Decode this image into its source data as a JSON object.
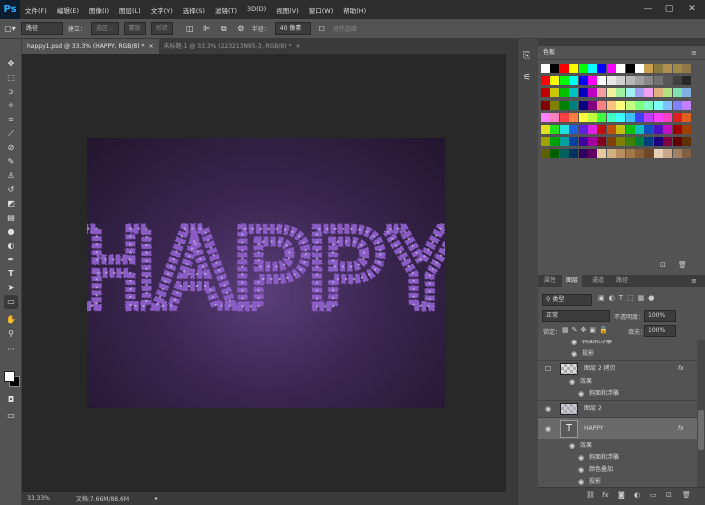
{
  "app": {
    "logo": "Ps"
  },
  "menu": [
    "文件(F)",
    "编辑(E)",
    "图像(I)",
    "图层(L)",
    "文字(Y)",
    "选择(S)",
    "滤镜(T)",
    "3D(D)",
    "视图(V)",
    "窗口(W)",
    "帮助(H)"
  ],
  "window_controls": {
    "minimize": "—",
    "maximize": "▢",
    "close": "✕"
  },
  "options": {
    "mode": "路径",
    "create_label": "建立：",
    "selection": "选区...",
    "mask": "蒙版",
    "shape": "形状",
    "radius_label": "半径：",
    "radius_value": "40 像素",
    "align_edges": "对齐边缘"
  },
  "tabs": [
    {
      "label": "happy1.psd @ 33.3% (HAPPY, RGB/8) *",
      "close": "×"
    },
    {
      "label": "未标题-1 @ 33.3% (223213N95-3, RGB/8) *",
      "close": "×"
    }
  ],
  "canvas": {
    "text": "HAPPY",
    "text_color": "#8a5bc4",
    "bg_color": "#3a2650"
  },
  "status": {
    "zoom": "33.33%",
    "doc": "文档:7.66M/88.6M"
  },
  "swatches_panel": {
    "title": "色板"
  },
  "swatch_colors": [
    [
      "#ffffff",
      "#000000",
      "#ff0000",
      "#ffff00",
      "#00ff00",
      "#00ffff",
      "#0000ff",
      "#ff00ff",
      "#ffffff",
      "#000000",
      "#ffffff",
      "#c8a050",
      "#8a7a40",
      "#b09050",
      "#a08848",
      "#907848"
    ],
    [
      "#ff0000",
      "#ffff00",
      "#00ff00",
      "#00ffff",
      "#0000ff",
      "#ff00ff",
      "#ffffff",
      "#e8e8e8",
      "#d0d0d0",
      "#b8b8b8",
      "#a0a0a0",
      "#888888",
      "#707070",
      "#585858",
      "#404040",
      "#282828"
    ],
    [
      "#c00000",
      "#c8c800",
      "#00c000",
      "#00c0c0",
      "#0000c0",
      "#c000c0",
      "#f0a0a0",
      "#f0f0a0",
      "#a0f0a0",
      "#a0f0f0",
      "#a0a0f0",
      "#f0a0f0",
      "#e0b080",
      "#b0e080",
      "#80e0b0",
      "#80b0e0"
    ],
    [
      "#800000",
      "#808000",
      "#008000",
      "#008080",
      "#000080",
      "#800080",
      "#ff8080",
      "#ffc080",
      "#ffff80",
      "#c0ff80",
      "#80ff80",
      "#80ffc0",
      "#80ffff",
      "#80c0ff",
      "#8080ff",
      "#c080ff"
    ],
    [
      "#ff80ff",
      "#ff80c0",
      "#ff4040",
      "#ff8040",
      "#ffff40",
      "#c0ff40",
      "#40ff40",
      "#40ffc0",
      "#40ffff",
      "#40c0ff",
      "#4040ff",
      "#c040ff",
      "#ff40ff",
      "#ff40c0",
      "#e02020",
      "#e06020"
    ],
    [
      "#e0e020",
      "#20e020",
      "#20e0e0",
      "#2060e0",
      "#6020e0",
      "#e020e0",
      "#c01010",
      "#c05010",
      "#c0c010",
      "#10c010",
      "#10c0c0",
      "#1050c0",
      "#5010c0",
      "#c010c0",
      "#a00000",
      "#a04000"
    ],
    [
      "#a0a000",
      "#00a000",
      "#00a0a0",
      "#0040a0",
      "#4000a0",
      "#a000a0",
      "#800020",
      "#804000",
      "#808000",
      "#408000",
      "#008040",
      "#004080",
      "#200080",
      "#800040",
      "#600000",
      "#603000"
    ],
    [
      "#606000",
      "#006000",
      "#006060",
      "#003060",
      "#300060",
      "#600060",
      "#e8c8a0",
      "#d0b080",
      "#b89060",
      "#a07848",
      "#886038",
      "#704828",
      "#e8d0b8",
      "#c8a888",
      "#a08060",
      "#806040"
    ]
  ],
  "layers_panel": {
    "tabs": [
      "属性",
      "图层",
      "通道",
      "路径"
    ],
    "filter_kind": "类型",
    "blend_mode": "正常",
    "opacity_label": "不透明度：",
    "opacity_value": "100%",
    "lock_label": "锁定：",
    "fill_label": "填充：",
    "fill_value": "100%",
    "rows": {
      "partial_effect": "斜面和浮雕",
      "shadow1": "投影",
      "layer2_copy": "图层 2 拷贝",
      "effects1": "效果",
      "bevel1": "斜面和浮雕",
      "layer2": "图层 2",
      "happy": "HAPPY",
      "effects2": "效果",
      "bevel2": "斜面和浮雕",
      "color_overlay": "颜色叠加",
      "shadow2": "投影"
    },
    "fx": "fx",
    "text_thumb": "T"
  }
}
